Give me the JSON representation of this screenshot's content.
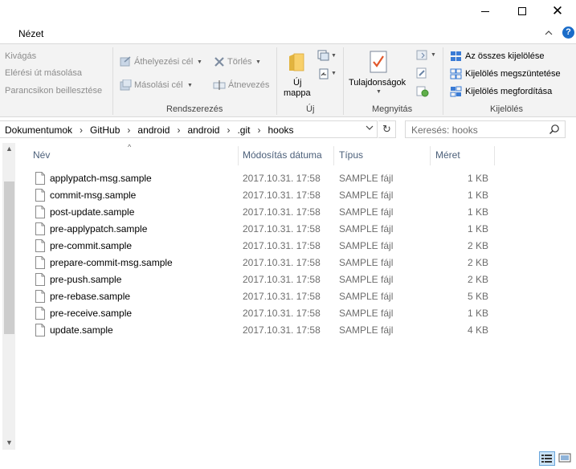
{
  "window": {
    "minimize_icon": "minimize-icon",
    "maximize_icon": "maximize-icon",
    "close_icon": "close-icon"
  },
  "ribbon_tabs": {
    "active_tab": "Nézet",
    "collapse_glyph": "^",
    "help_glyph": "?"
  },
  "ribbon": {
    "clipboard": {
      "cut": "Kivágás",
      "copy_path": "Elérési út másolása",
      "paste_shortcut": "Parancsikon beillesztése"
    },
    "organize": {
      "move_to": "Áthelyezési cél",
      "copy_to": "Másolási cél",
      "delete": "Törlés",
      "rename": "Átnevezés",
      "group_name": "Rendszerezés"
    },
    "new": {
      "new_folder_line1": "Új",
      "new_folder_line2": "mappa",
      "group_name": "Új"
    },
    "open": {
      "properties": "Tulajdonságok",
      "group_name": "Megnyitás"
    },
    "select": {
      "select_all": "Az összes kijelölése",
      "select_none": "Kijelölés megszüntetése",
      "invert_selection": "Kijelölés megfordítása",
      "group_name": "Kijelölés"
    }
  },
  "address": {
    "crumbs": [
      "Dokumentumok",
      "GitHub",
      "android",
      "android",
      ".git",
      "hooks"
    ],
    "separator": "›",
    "refresh_glyph": "↻",
    "dropdown_glyph": "∨"
  },
  "search": {
    "placeholder": "Keresés: hooks"
  },
  "columns": {
    "name": "Név",
    "date": "Módosítás dátuma",
    "type": "Típus",
    "size": "Méret"
  },
  "files": [
    {
      "name": "applypatch-msg.sample",
      "date": "2017.10.31. 17:58",
      "type": "SAMPLE fájl",
      "size": "1 KB"
    },
    {
      "name": "commit-msg.sample",
      "date": "2017.10.31. 17:58",
      "type": "SAMPLE fájl",
      "size": "1 KB"
    },
    {
      "name": "post-update.sample",
      "date": "2017.10.31. 17:58",
      "type": "SAMPLE fájl",
      "size": "1 KB"
    },
    {
      "name": "pre-applypatch.sample",
      "date": "2017.10.31. 17:58",
      "type": "SAMPLE fájl",
      "size": "1 KB"
    },
    {
      "name": "pre-commit.sample",
      "date": "2017.10.31. 17:58",
      "type": "SAMPLE fájl",
      "size": "2 KB"
    },
    {
      "name": "prepare-commit-msg.sample",
      "date": "2017.10.31. 17:58",
      "type": "SAMPLE fájl",
      "size": "2 KB"
    },
    {
      "name": "pre-push.sample",
      "date": "2017.10.31. 17:58",
      "type": "SAMPLE fájl",
      "size": "2 KB"
    },
    {
      "name": "pre-rebase.sample",
      "date": "2017.10.31. 17:58",
      "type": "SAMPLE fájl",
      "size": "5 KB"
    },
    {
      "name": "pre-receive.sample",
      "date": "2017.10.31. 17:58",
      "type": "SAMPLE fájl",
      "size": "1 KB"
    },
    {
      "name": "update.sample",
      "date": "2017.10.31. 17:58",
      "type": "SAMPLE fájl",
      "size": "4 KB"
    }
  ],
  "status": {
    "details_view_icon": "details-view-icon",
    "large_icons_view_icon": "large-icons-view-icon"
  },
  "colors": {
    "accent": "#1a6cc9",
    "header_text": "#4c607a",
    "secondary_text": "#6d6d6d",
    "ribbon_bg": "#f3f3f3"
  }
}
